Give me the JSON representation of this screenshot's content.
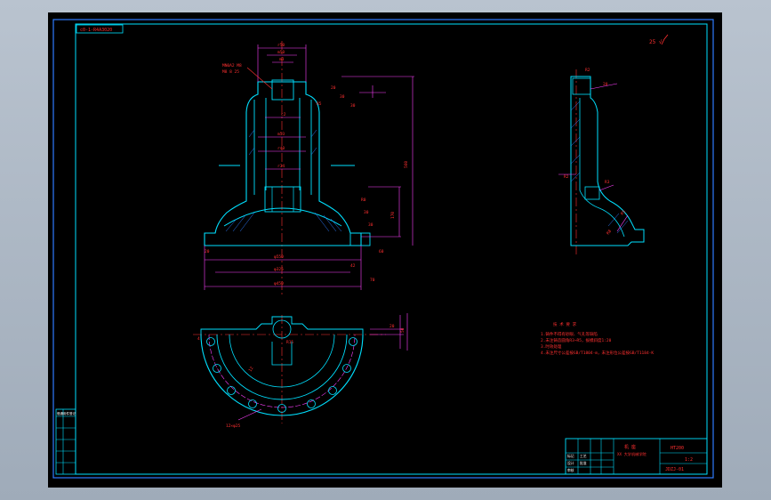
{
  "drawing": {
    "title_tag": "c0-1-R4A3020",
    "roughness_note": "25 √",
    "front_view": {
      "leader_note_top": "MN0A2 M8",
      "leader_note_bottom": "M8 8 25",
      "dims_top": [
        "r50",
        "20",
        "30",
        "30",
        "R5"
      ],
      "dims_inner": [
        "m50",
        "m3",
        "c2",
        "m53",
        "r40",
        "r34"
      ],
      "dim_overall_height": "560",
      "dims_right": [
        "R0",
        "30",
        "30",
        "170",
        "60"
      ],
      "dims_bottom": [
        "φ550",
        "φ325",
        "φ450",
        "42",
        "70"
      ],
      "dim_left": "20"
    },
    "side_view": {
      "dims": [
        "R2",
        "20",
        "R2",
        "R3",
        "R8",
        "R5"
      ]
    },
    "plan_view": {
      "dims": [
        "4",
        "50",
        "20",
        "12",
        "R15"
      ],
      "pcd_label": "12×φ25"
    },
    "tech_requirements": {
      "title": "技 术 要 求",
      "lines": [
        "1.铸件不得有砂眼、气孔等缺陷",
        "2.未注铸造圆角R3~R5，拔模斜度1:20",
        "3.时效处理",
        "4.未注尺寸公差按GB/T1804-m，未注形位公差按GB/T1184-K"
      ]
    },
    "title_block": {
      "part_name": "机 座",
      "school": "XX 大学机械学院",
      "material": "HT200",
      "scale": "1:2",
      "drawing_no": "JDZJ-01",
      "rows": [
        "标记",
        "设计",
        "审核",
        "工艺",
        "批准"
      ]
    },
    "left_margin_block": {
      "header": "借通用件登记",
      "rows": [
        "",
        "",
        "",
        "",
        ""
      ]
    }
  }
}
